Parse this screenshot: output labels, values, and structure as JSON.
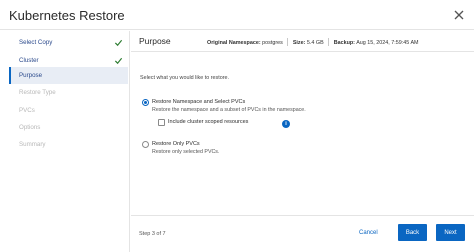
{
  "header": {
    "title": "Kubernetes Restore",
    "close_icon": "close-icon"
  },
  "sidebar": {
    "steps": [
      {
        "label": "Select Copy",
        "state": "completed",
        "icon": "check-icon"
      },
      {
        "label": "Cluster",
        "state": "completed",
        "icon": "check-icon"
      },
      {
        "label": "Purpose",
        "state": "active"
      },
      {
        "label": "Restore Type",
        "state": "disabled"
      },
      {
        "label": "PVCs",
        "state": "disabled"
      },
      {
        "label": "Options",
        "state": "disabled"
      },
      {
        "label": "Summary",
        "state": "disabled"
      }
    ]
  },
  "main": {
    "title": "Purpose",
    "meta": {
      "namespace_label": "Original Namespace:",
      "namespace_value": "postgres",
      "size_label": "Size:",
      "size_value": "5.4 GB",
      "backup_label": "Backup:",
      "backup_value": "Aug 15, 2024, 7:59:45 AM"
    },
    "prompt": "Select what you would like to restore.",
    "options": [
      {
        "label": "Restore Namespace and Select PVCs",
        "description": "Restore the namespace and a subset of PVCs in the namespace.",
        "selected": true,
        "checkbox_label": "Include cluster scoped resources",
        "checkbox_checked": false,
        "info_icon": "info-icon"
      },
      {
        "label": "Restore Only PVCs",
        "description": "Restore only selected PVCs.",
        "selected": false
      }
    ]
  },
  "footer": {
    "step_text": "Step 3 of 7",
    "cancel_label": "Cancel",
    "back_label": "Back",
    "next_label": "Next"
  },
  "colors": {
    "accent": "#0a66c2",
    "check": "#2e7d32",
    "active_bg": "#e8edf5"
  }
}
